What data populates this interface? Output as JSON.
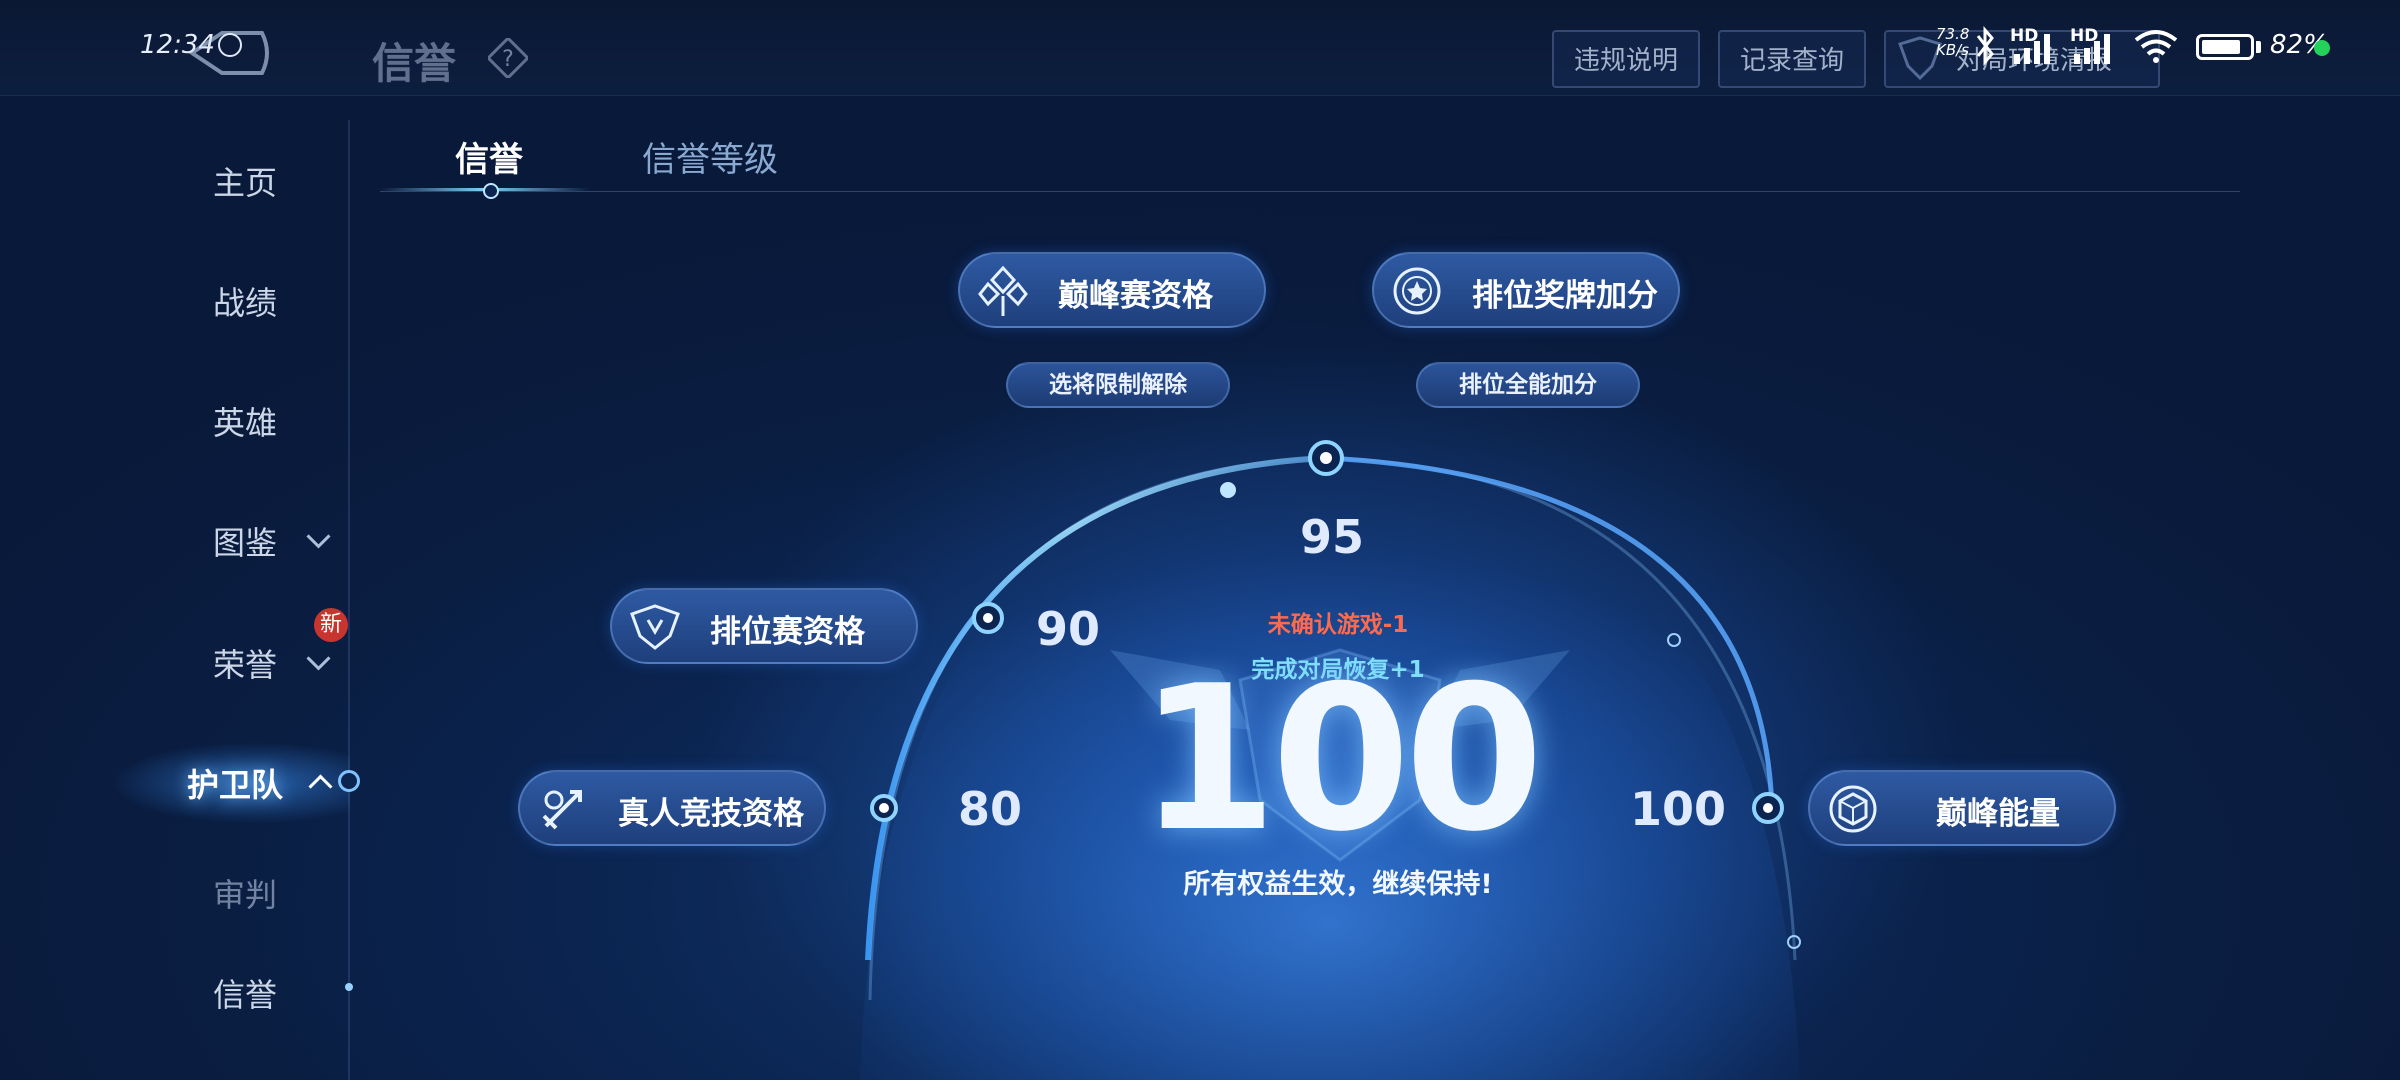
{
  "status_bar": {
    "time": "12:34",
    "net_speed_top": "73.8",
    "net_speed_unit": "KB/s",
    "hd1": "HD",
    "hd2": "HD",
    "battery_percent": 82,
    "battery_text": "82%"
  },
  "header": {
    "title": "信誉",
    "buttons": [
      "违规说明",
      "记录查询",
      "对局环境清报"
    ]
  },
  "sidebar": {
    "items": [
      {
        "label": "主页"
      },
      {
        "label": "战绩"
      },
      {
        "label": "英雄"
      },
      {
        "label": "图鉴"
      },
      {
        "label": "荣誉"
      },
      {
        "label": "护卫队"
      },
      {
        "label": "审判"
      },
      {
        "label": "信誉"
      }
    ],
    "new_badge": "新"
  },
  "tabs": [
    {
      "label": "信誉"
    },
    {
      "label": "信誉等级"
    }
  ],
  "privileges": {
    "peak": "巅峰赛资格",
    "peak_sub": "选将限制解除",
    "rank_medal": "排位奖牌加分",
    "rank_medal_sub": "排位全能加分",
    "ranked": "排位赛资格",
    "real_comp": "真人竞技资格",
    "peak_energy": "巅峰能量"
  },
  "gauge": {
    "ticks": [
      "80",
      "90",
      "95",
      "100"
    ],
    "score": "100",
    "warning": "未确认游戏-1",
    "recover": "完成对局恢复+1",
    "status": "所有权益生效，继续保持!"
  },
  "colors": {
    "accent": "#7fd0ff",
    "warning": "#ff6a4f",
    "recover": "#7fe0ff",
    "badge": "#c8352f",
    "online": "#22d25a"
  }
}
